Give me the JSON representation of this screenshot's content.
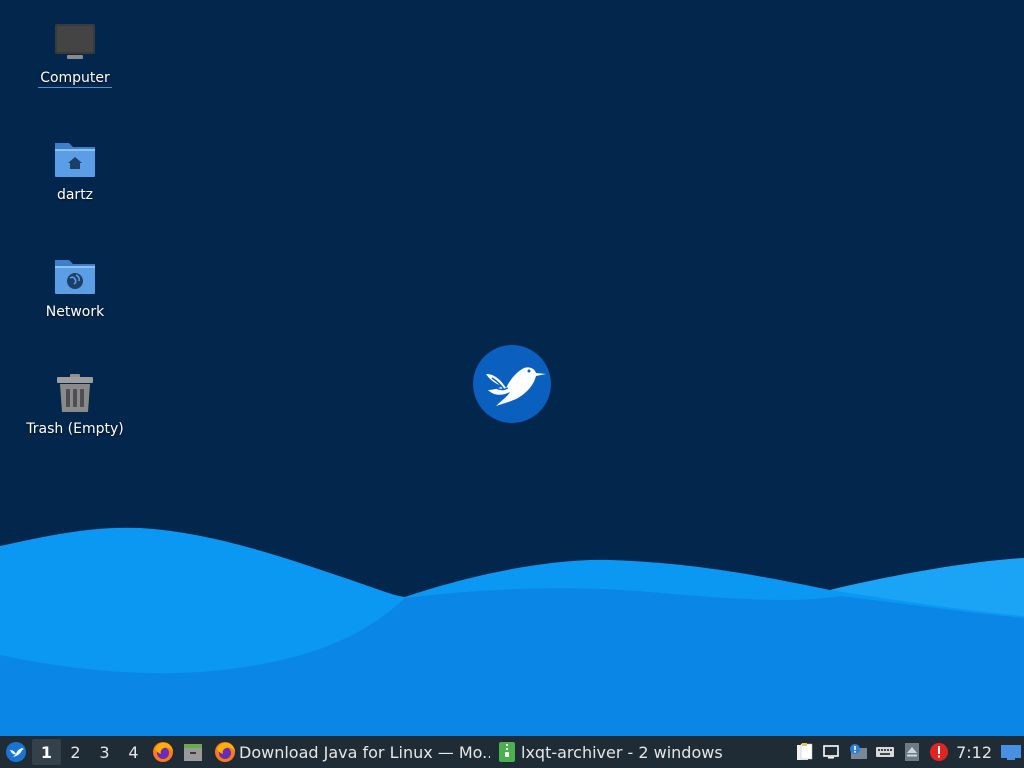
{
  "desktop": {
    "icons": [
      {
        "label": "Computer",
        "icon": "computer-icon"
      },
      {
        "label": "dartz",
        "icon": "home-folder-icon"
      },
      {
        "label": "Network",
        "icon": "network-folder-icon"
      },
      {
        "label": "Trash (Empty)",
        "icon": "trash-icon"
      }
    ],
    "wallpaper_logo": "hummingbird-logo-icon"
  },
  "panel": {
    "menu_icon": "lubuntu-menu-icon",
    "desktops": [
      "1",
      "2",
      "3",
      "4"
    ],
    "active_desktop": "1",
    "quicklaunch": [
      "firefox-icon",
      "file-manager-icon"
    ],
    "tasks": [
      {
        "label": "Download Java for Linux — Mo...",
        "icon": "firefox-icon"
      },
      {
        "label": "lxqt-archiver - 2 windows",
        "icon": "archiver-icon"
      }
    ],
    "tray": [
      "clipboard-icon",
      "display-icon",
      "update-notifier-icon",
      "keyboard-icon",
      "eject-icon",
      "alert-icon"
    ],
    "clock": "7:12",
    "show_desktop_icon": "show-desktop-icon"
  },
  "colors": {
    "background": "#03264c",
    "wave_light": "#0a98f2",
    "wave_mid": "#0a86e6",
    "panel": "#1f2c36",
    "logo": "#0a5fbf",
    "selection": "#4a90d9"
  }
}
